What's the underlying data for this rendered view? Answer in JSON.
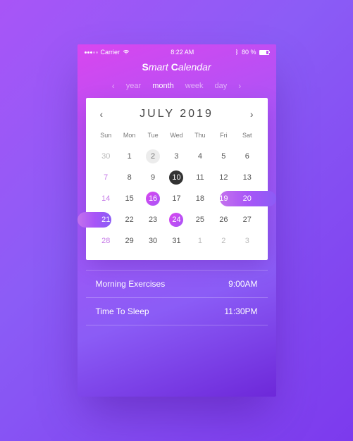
{
  "statusbar": {
    "carrier": "Carrier",
    "time": "8:22 AM",
    "battery": "80 %"
  },
  "app": {
    "title_a": "S",
    "title_b": "mart ",
    "title_c": "C",
    "title_d": "alendar"
  },
  "tabs": {
    "year": "year",
    "month": "month",
    "week": "week",
    "day": "day"
  },
  "nav": {
    "prev": "‹",
    "next": "›",
    "monthprev": "‹",
    "monthnext": "›"
  },
  "month": {
    "label": "JULY 2019"
  },
  "dow": {
    "sun": "Sun",
    "mon": "Mon",
    "tue": "Tue",
    "wed": "Wed",
    "thu": "Thu",
    "fri": "Fri",
    "sat": "Sat"
  },
  "grid": {
    "w1": [
      "30",
      "1",
      "2",
      "3",
      "4",
      "5",
      "6"
    ],
    "w2": [
      "7",
      "8",
      "9",
      "10",
      "11",
      "12",
      "13"
    ],
    "w3": [
      "14",
      "15",
      "16",
      "17",
      "18",
      "19",
      "20"
    ],
    "w4": [
      "21",
      "22",
      "23",
      "24",
      "25",
      "26",
      "27"
    ],
    "w5": [
      "28",
      "29",
      "30",
      "31",
      "1",
      "2",
      "3"
    ]
  },
  "range1": {
    "a": "19",
    "b": "20"
  },
  "range2": {
    "a": "21"
  },
  "events": [
    {
      "name": "Morning Exercises",
      "time": "9:00AM"
    },
    {
      "name": "Time To Sleep",
      "time": "11:30PM"
    }
  ]
}
